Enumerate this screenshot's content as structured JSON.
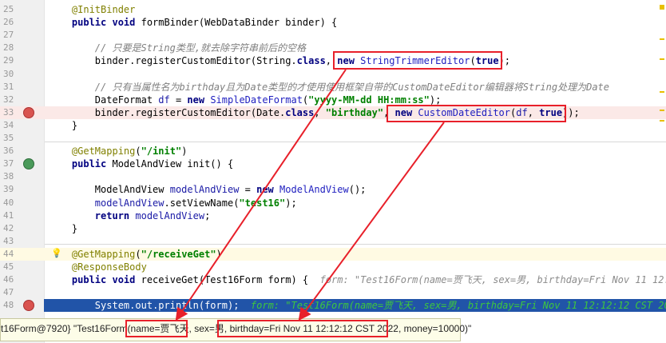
{
  "editor": {
    "lines": [
      {
        "n": "25",
        "tokens": [
          [
            "    ",
            ""
          ],
          [
            "@InitBinder",
            "ann"
          ]
        ]
      },
      {
        "n": "26",
        "tokens": [
          [
            "    ",
            ""
          ],
          [
            "public void ",
            "kw"
          ],
          [
            "formBinder(WebDataBinder binder) {",
            ""
          ]
        ]
      },
      {
        "n": "27",
        "tokens": []
      },
      {
        "n": "28",
        "tokens": [
          [
            "        ",
            ""
          ],
          [
            "// 只要是String类型,就去除字符串前后的空格",
            "cm"
          ]
        ]
      },
      {
        "n": "29",
        "tokens": [
          [
            "        ",
            ""
          ],
          [
            "binder.registerCustomEditor(String.",
            ""
          ],
          [
            "class",
            "kw"
          ],
          [
            ", ",
            ""
          ],
          [
            "new ",
            "kw"
          ],
          [
            "StringTrimmerEditor",
            "cls"
          ],
          [
            "(",
            ""
          ],
          [
            "true",
            "kw"
          ],
          [
            ");",
            ""
          ]
        ]
      },
      {
        "n": "30",
        "tokens": []
      },
      {
        "n": "31",
        "tokens": [
          [
            "        ",
            ""
          ],
          [
            "// 只有当属性名为birthday且为Date类型的才使用使用框架自带的CustomDateEditor编辑器将String处理为Date",
            "cm"
          ]
        ]
      },
      {
        "n": "32",
        "tokens": [
          [
            "        ",
            ""
          ],
          [
            "DateFormat ",
            ""
          ],
          [
            "df",
            "var"
          ],
          [
            " = ",
            ""
          ],
          [
            "new ",
            "kw"
          ],
          [
            "SimpleDateFormat",
            "cls"
          ],
          [
            "(",
            ""
          ],
          [
            "\"yyyy-MM-dd HH:mm:ss\"",
            "str"
          ],
          [
            ");",
            ""
          ]
        ]
      },
      {
        "n": "33",
        "tokens": [
          [
            "        ",
            ""
          ],
          [
            "binder.registerCustomEditor(Date.",
            ""
          ],
          [
            "class",
            "kw"
          ],
          [
            ", ",
            ""
          ],
          [
            "\"birthday\"",
            "str"
          ],
          [
            ", ",
            ""
          ],
          [
            "new ",
            "kw"
          ],
          [
            "CustomDateEditor",
            "cls"
          ],
          [
            "(",
            ""
          ],
          [
            "df",
            "var"
          ],
          [
            ", ",
            ""
          ],
          [
            "true",
            "kw"
          ],
          [
            "));",
            ""
          ]
        ]
      },
      {
        "n": "34",
        "tokens": [
          [
            "    }",
            ""
          ]
        ]
      },
      {
        "n": "35",
        "tokens": []
      },
      {
        "n": "36",
        "tokens": [
          [
            "    ",
            ""
          ],
          [
            "@GetMapping",
            "ann"
          ],
          [
            "(",
            ""
          ],
          [
            "\"/init\"",
            "str"
          ],
          [
            ")",
            ""
          ]
        ]
      },
      {
        "n": "37",
        "tokens": [
          [
            "    ",
            ""
          ],
          [
            "public ",
            "kw"
          ],
          [
            "ModelAndView init() {",
            ""
          ]
        ]
      },
      {
        "n": "38",
        "tokens": []
      },
      {
        "n": "39",
        "tokens": [
          [
            "        ",
            ""
          ],
          [
            "ModelAndView ",
            ""
          ],
          [
            "modelAndView",
            "var"
          ],
          [
            " = ",
            ""
          ],
          [
            "new ",
            "kw"
          ],
          [
            "ModelAndView",
            "cls"
          ],
          [
            "();",
            ""
          ]
        ]
      },
      {
        "n": "40",
        "tokens": [
          [
            "        ",
            ""
          ],
          [
            "modelAndView",
            "var"
          ],
          [
            ".setViewName(",
            ""
          ],
          [
            "\"test16\"",
            "str"
          ],
          [
            ");",
            ""
          ]
        ]
      },
      {
        "n": "41",
        "tokens": [
          [
            "        ",
            ""
          ],
          [
            "return ",
            "kw"
          ],
          [
            "modelAndView",
            "var"
          ],
          [
            ";",
            ""
          ]
        ]
      },
      {
        "n": "42",
        "tokens": [
          [
            "    }",
            ""
          ]
        ]
      },
      {
        "n": "43",
        "tokens": []
      },
      {
        "n": "44",
        "tokens": [
          [
            "    ",
            ""
          ],
          [
            "@GetMapping",
            "ann"
          ],
          [
            "(",
            ""
          ],
          [
            "\"/receiveGet\"",
            "str"
          ],
          [
            ")",
            ""
          ]
        ]
      },
      {
        "n": "45",
        "tokens": [
          [
            "    ",
            ""
          ],
          [
            "@ResponseBody",
            "ann"
          ]
        ]
      },
      {
        "n": "46",
        "tokens": [
          [
            "    ",
            ""
          ],
          [
            "public void ",
            "kw"
          ],
          [
            "receiveGet(Test16Form form) {  ",
            ""
          ],
          [
            "form: \"Test16Form(name=贾飞天, sex=男, birthday=Fri Nov 11 12:",
            "hint"
          ]
        ]
      },
      {
        "n": "47",
        "tokens": []
      },
      {
        "n": "48",
        "tokens": [
          [
            "        ",
            ""
          ],
          [
            "System.",
            "wht"
          ],
          [
            "out",
            "wht"
          ],
          [
            ".println(form);  ",
            "wht"
          ],
          [
            "form: \"Test16Form(name=贾飞天, sex=男, birthday=Fri Nov 11 12:12:12 CST 20",
            "hint2"
          ]
        ]
      }
    ]
  },
  "tooltip": {
    "prefix": "t16Form@7920} \"Test16Form(",
    "name": "name=贾飞天,",
    "sex": " sex=男,",
    "birthday": "birthday=Fri Nov 11 12:12:12 CST 2022,",
    "suffix": " money=10000)\""
  },
  "colors": {
    "highlight": "#2154a8",
    "breakpoint_row": "#fbe9e7",
    "annotation": "#e8202a"
  }
}
